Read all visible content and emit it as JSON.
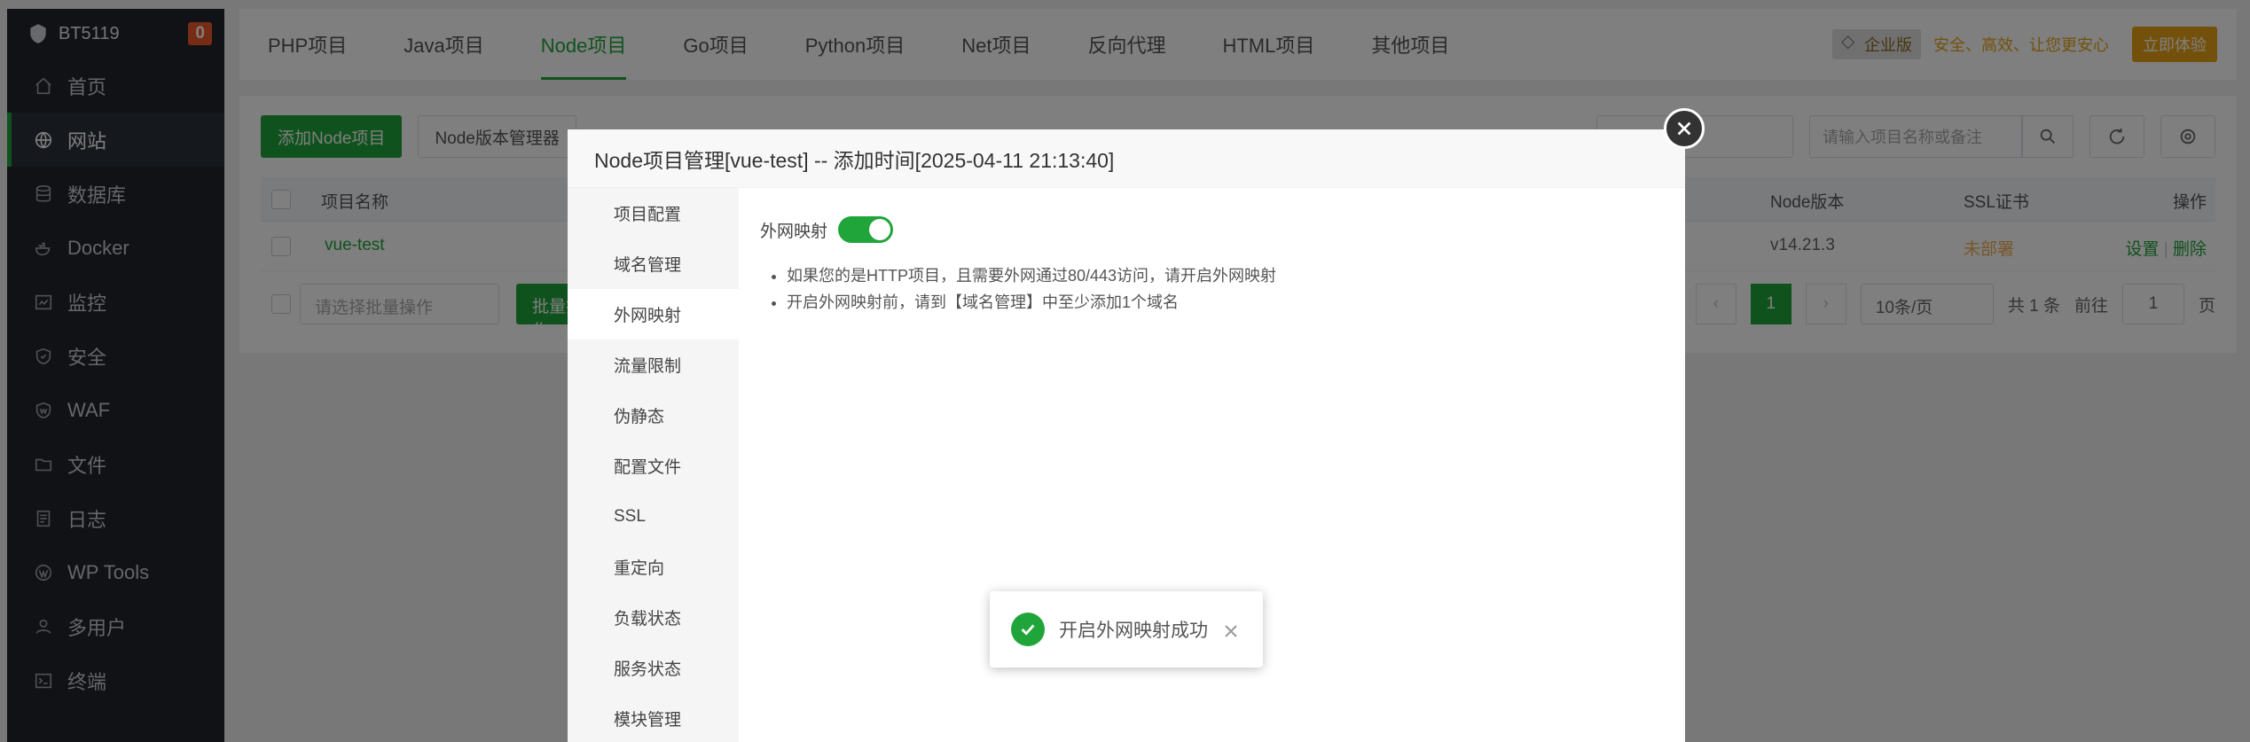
{
  "sidebar": {
    "host": "BT5119",
    "badge": "0",
    "items": [
      {
        "label": "首页",
        "icon": "home-icon"
      },
      {
        "label": "网站",
        "icon": "globe-icon",
        "active": true
      },
      {
        "label": "数据库",
        "icon": "database-icon"
      },
      {
        "label": "Docker",
        "icon": "docker-icon"
      },
      {
        "label": "监控",
        "icon": "monitor-icon"
      },
      {
        "label": "安全",
        "icon": "shield-icon"
      },
      {
        "label": "WAF",
        "icon": "waf-icon"
      },
      {
        "label": "文件",
        "icon": "folder-icon"
      },
      {
        "label": "日志",
        "icon": "log-icon"
      },
      {
        "label": "WP Tools",
        "icon": "wordpress-icon"
      },
      {
        "label": "多用户",
        "icon": "users-icon"
      },
      {
        "label": "终端",
        "icon": "terminal-icon"
      }
    ]
  },
  "topbar": {
    "tabs": [
      "PHP项目",
      "Java项目",
      "Node项目",
      "Go项目",
      "Python项目",
      "Net项目",
      "反向代理",
      "HTML项目",
      "其他项目"
    ],
    "active_tab": "Node项目",
    "edition": "企业版",
    "slogan": "安全、高效、让您更安心",
    "try_label": "立即体验"
  },
  "content": {
    "add_button": "添加Node项目",
    "version_button": "Node版本管理器",
    "search_placeholder": "请输入项目名称或备注",
    "columns": {
      "name": "项目名称",
      "node_version": "Node版本",
      "ssl": "SSL证书",
      "ops": "操作"
    },
    "row": {
      "name": "vue-test",
      "node_version": "v14.21.3",
      "ssl": "未部署",
      "set": "设置",
      "delete": "删除"
    },
    "batch_placeholder": "请选择批量操作",
    "batch_button": "批量操作",
    "pager": {
      "current": "1",
      "page_size": "10条/页",
      "total": "共 1 条",
      "goto": "前往",
      "page_input": "1",
      "page_unit": "页"
    }
  },
  "modal": {
    "title": "Node项目管理[vue-test] -- 添加时间[2025-04-11 21:13:40]",
    "side_items": [
      "项目配置",
      "域名管理",
      "外网映射",
      "流量限制",
      "伪静态",
      "配置文件",
      "SSL",
      "重定向",
      "负载状态",
      "服务状态",
      "模块管理"
    ],
    "active_side": "外网映射",
    "switch_label": "外网映射",
    "switch_on": true,
    "tips": [
      "如果您的是HTTP项目，且需要外网通过80/443访问，请开启外网映射",
      "开启外网映射前，请到【域名管理】中至少添加1个域名"
    ]
  },
  "toast": {
    "message": "开启外网映射成功"
  }
}
